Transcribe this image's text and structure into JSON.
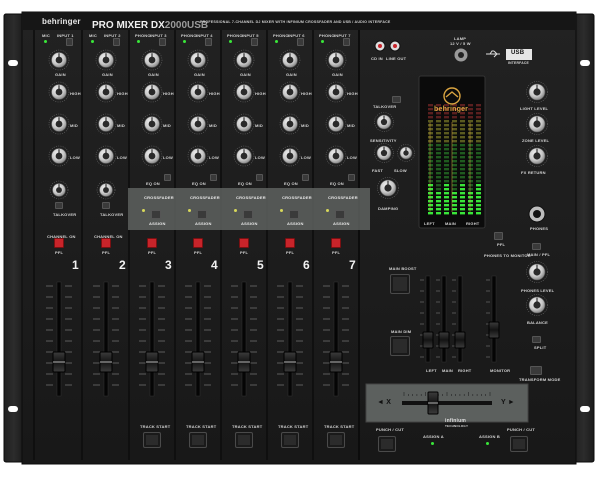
{
  "brand": {
    "name": "behringer",
    "model": "PRO MIXER DX2000USB",
    "model_prefix": "PRO MIXER DX",
    "model_suffix": "2000USB"
  },
  "tagline": "PROFESSIONAL 7-CHANNEL DJ MIXER WITH INFINIUM CROSSFADER AND USB / AUDIO INTERFACE",
  "meter_logo": "behringer",
  "usb_label": "USB",
  "usb_sub": "INTERFACE",
  "lamp_label": "LAMP",
  "lamp_sub": "12 V / 5 W",
  "cd_in": "CD IN",
  "line_out": "LINE OUT",
  "inputs": [
    "INPUT 1",
    "INPUT 2",
    "INPUT 3",
    "INPUT 4",
    "INPUT 5",
    "INPUT 6",
    "INPUT 7"
  ],
  "channels": [
    {
      "num": "1",
      "top": "MIC",
      "gain": "GAIN",
      "eq": [
        "HIGH",
        "MID",
        "LOW"
      ],
      "pfl": "PFL",
      "on": "CHANNEL ON",
      "track": ""
    },
    {
      "num": "2",
      "top": "MIC",
      "gain": "GAIN",
      "eq": [
        "HIGH",
        "MID",
        "LOW"
      ],
      "pfl": "PFL",
      "on": "CHANNEL ON",
      "track": ""
    },
    {
      "num": "3",
      "top": "PHONO",
      "gain": "GAIN",
      "eq": [
        "HIGH",
        "MID",
        "LOW"
      ],
      "pfl": "PFL",
      "on": "EQ ON",
      "track": "TRACK START"
    },
    {
      "num": "4",
      "top": "PHONO",
      "gain": "GAIN",
      "eq": [
        "HIGH",
        "MID",
        "LOW"
      ],
      "pfl": "PFL",
      "on": "EQ ON",
      "track": "TRACK START"
    },
    {
      "num": "5",
      "top": "PHONO",
      "gain": "GAIN",
      "eq": [
        "HIGH",
        "MID",
        "LOW"
      ],
      "pfl": "PFL",
      "on": "EQ ON",
      "track": "TRACK START"
    },
    {
      "num": "6",
      "top": "PHONO",
      "gain": "GAIN",
      "eq": [
        "HIGH",
        "MID",
        "LOW"
      ],
      "pfl": "PFL",
      "on": "EQ ON",
      "track": "TRACK START"
    },
    {
      "num": "7",
      "top": "PHONO",
      "gain": "GAIN",
      "eq": [
        "HIGH",
        "MID",
        "LOW"
      ],
      "pfl": "PFL",
      "on": "EQ ON",
      "track": "TRACK START"
    }
  ],
  "crossfader_assign": "CROSSFADER",
  "assign": "ASSIGN",
  "talkover": "TALKOVER",
  "talkover_right": "TALKOVER",
  "talkover_knobs": [
    "SENSITIVITY",
    "FAST",
    "SLOW",
    "DAMPING"
  ],
  "meter_labels": [
    "LEFT",
    "MAIN",
    "RIGHT"
  ],
  "pfl": "PFL",
  "phones": "PHONES",
  "phones_to_monitor": "PHONES TO MONITOR",
  "main_boost": "MAIN BOOST",
  "main_dim": "MAIN DIM",
  "fader_labels": [
    "LEFT",
    "MAIN",
    "RIGHT",
    "MONITOR"
  ],
  "right_knobs": [
    "LIGHT LEVEL",
    "ZONE LEVEL",
    "FX RETURN",
    "MAIN / PFL",
    "PHONES LEVEL",
    "BALANCE"
  ],
  "split": "SPLIT",
  "transform_mode": "TRANSFORM MODE",
  "punch_cut": "PUNCH / CUT",
  "assign_a": "ASSIGN A",
  "assign_b": "ASSIGN B",
  "xf_a": "◄ X",
  "xf_b": "Y ►",
  "infinium": "infinium",
  "infinium_sub": "TECHNOLOGY",
  "colors": {
    "panel": "#1c1c1c",
    "accent_red": "#c8242a",
    "led_green": "#39e639",
    "meter_gold": "#d9a441"
  }
}
